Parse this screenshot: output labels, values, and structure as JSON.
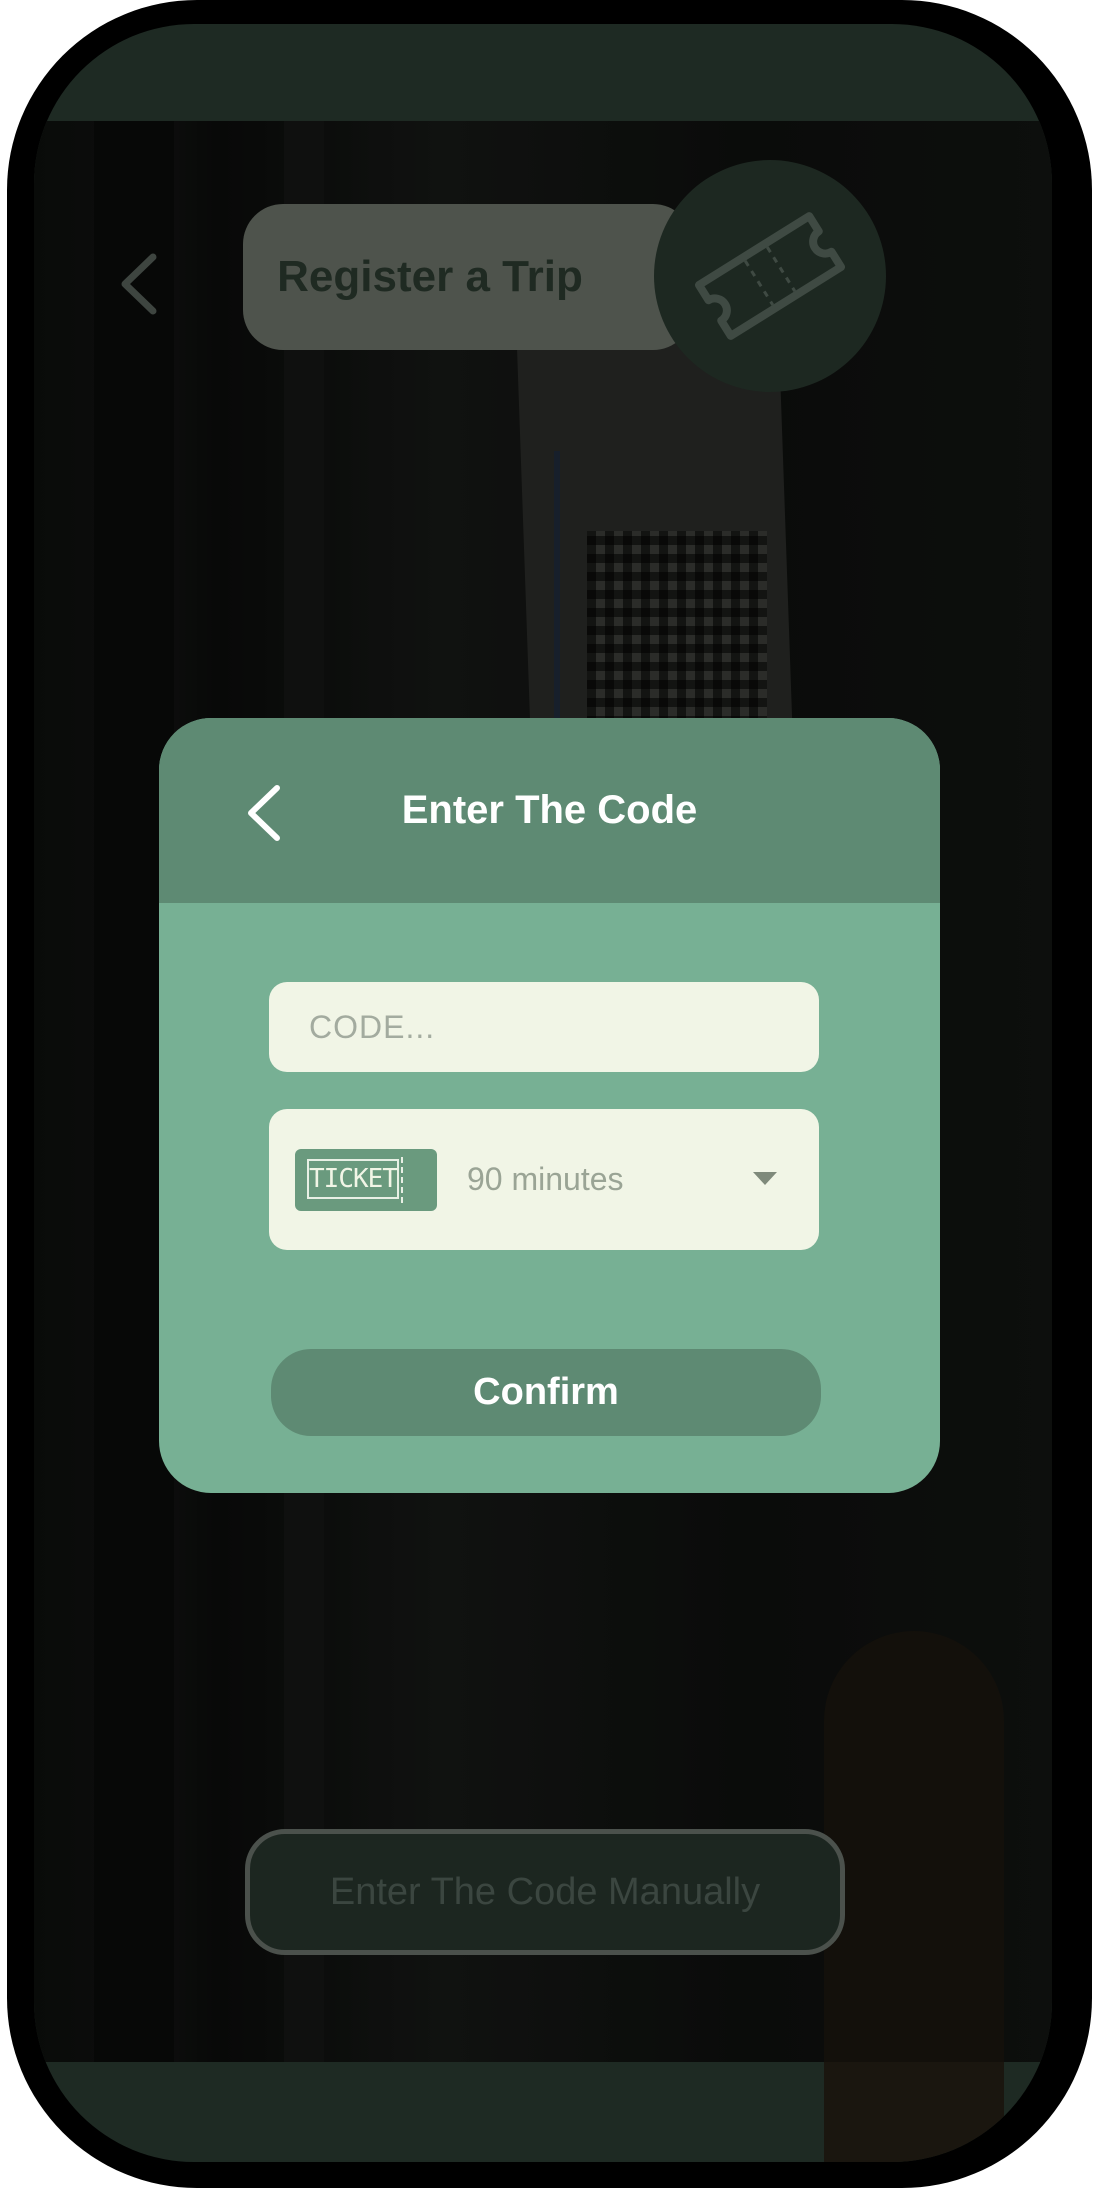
{
  "header": {
    "title": "Register a Trip",
    "back_icon": "chevron-left-icon",
    "badge_icon": "ticket-icon"
  },
  "modal": {
    "title": "Enter The Code",
    "back_icon": "chevron-left-icon",
    "code_input": {
      "placeholder": "CODE...",
      "value": ""
    },
    "ticket_select": {
      "badge_label": "TICKET",
      "selected": "90 minutes",
      "caret_icon": "caret-down-icon"
    },
    "confirm_label": "Confirm"
  },
  "footer": {
    "manual_button_label": "Enter The Code Manually"
  },
  "colors": {
    "modal_body": "#77b094",
    "modal_header": "#5e8a73",
    "input_bg": "#f1f5e6",
    "screen_bg": "#1e2a23"
  }
}
